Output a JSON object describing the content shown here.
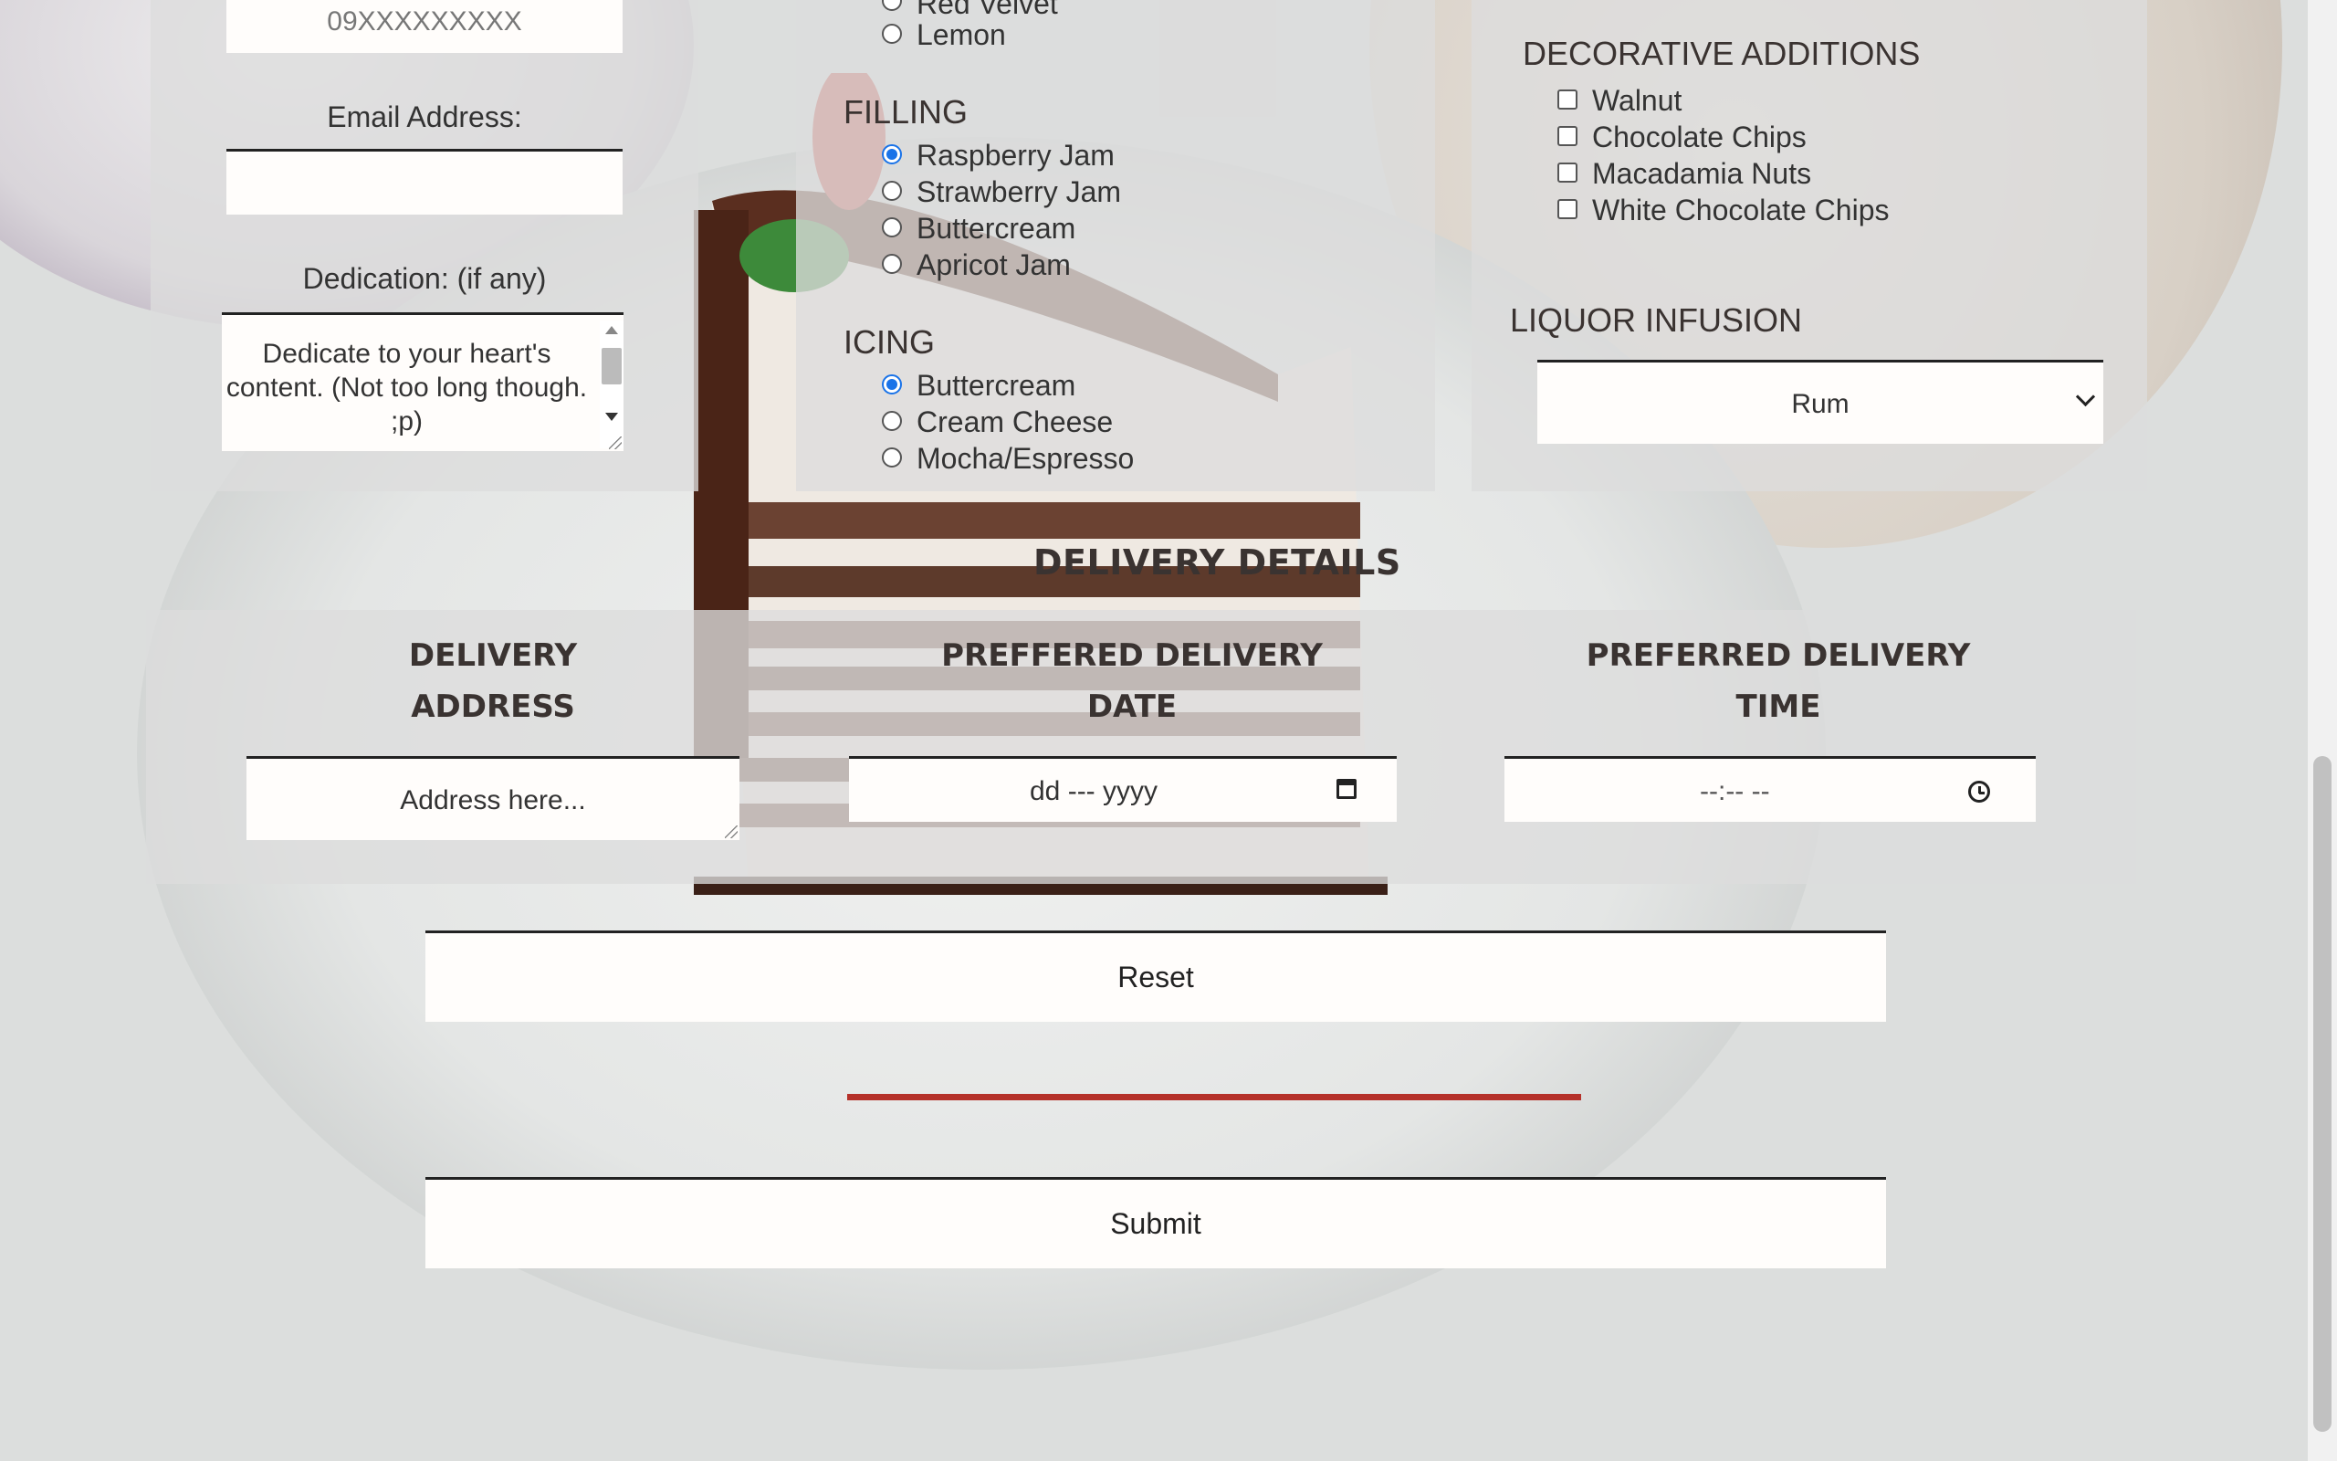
{
  "customer": {
    "phone_placeholder": "09XXXXXXXXX",
    "email_label": "Email Address:",
    "email_value": "",
    "dedication_label": "Dedication: (if any)",
    "dedication_placeholder": "Dedicate to your heart's content. (Not too long though. ;p)"
  },
  "cake_flavor": {
    "options": [
      "Red Velvet",
      "Lemon"
    ]
  },
  "filling": {
    "title": "FILLING",
    "options": [
      "Raspberry Jam",
      "Strawberry Jam",
      "Buttercream",
      "Apricot Jam"
    ],
    "selected": "Raspberry Jam"
  },
  "icing": {
    "title": "ICING",
    "options": [
      "Buttercream",
      "Cream Cheese",
      "Mocha/Espresso"
    ],
    "selected": "Buttercream"
  },
  "decorative": {
    "title": "DECORATIVE ADDITIONS",
    "options": [
      "Walnut",
      "Chocolate Chips",
      "Macadamia Nuts",
      "White Chocolate Chips"
    ]
  },
  "liquor": {
    "title": "LIQUOR INFUSION",
    "selected": "Rum"
  },
  "delivery": {
    "title": "DELIVERY DETAILS",
    "address_label_1": "DELIVERY",
    "address_label_2": "ADDRESS",
    "address_placeholder": "Address here...",
    "date_label_1": "PREFFERED DELIVERY",
    "date_label_2": "DATE",
    "date_placeholder": "dd --- yyyy",
    "time_label_1": "PREFERRED DELIVERY",
    "time_label_2": "TIME",
    "time_placeholder": "--:-- --"
  },
  "actions": {
    "reset_label": "Reset",
    "submit_label": "Submit"
  },
  "colors": {
    "accent": "#b5312a",
    "radio_selected": "#1a73e8"
  }
}
